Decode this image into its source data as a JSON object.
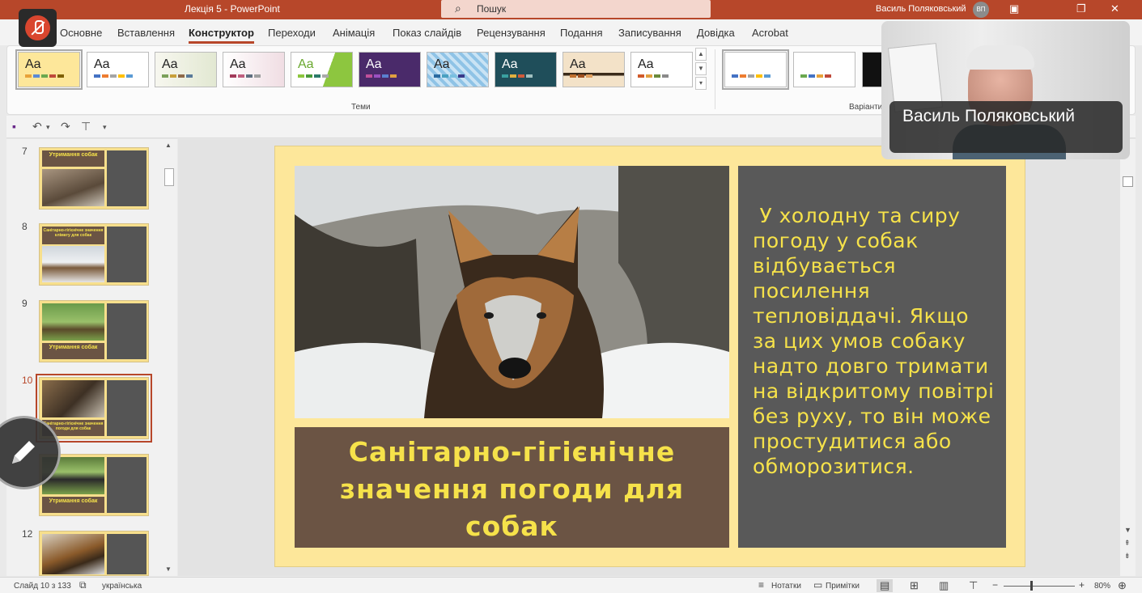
{
  "titlebar": {
    "title": "Лекція 5  -  PowerPoint",
    "search_placeholder": "Пошук",
    "user_name": "Василь Поляковський",
    "user_initials": "ВП"
  },
  "tabs": [
    "Основне",
    "Вставлення",
    "Конструктор",
    "Переходи",
    "Анімація",
    "Показ слайдів",
    "Рецензування",
    "Подання",
    "Записування",
    "Довідка",
    "Acrobat"
  ],
  "active_tab": "Конструктор",
  "ribbon": {
    "themes_label": "Теми",
    "variants_label": "Варіанти",
    "theme_sample": "Aa"
  },
  "slides_panel": {
    "thumbnails": [
      {
        "num": "7",
        "title": "Утримання собак"
      },
      {
        "num": "8",
        "title": "Санітарно-гігієнічне значення клімату для собак"
      },
      {
        "num": "9",
        "title": "Утримання собак"
      },
      {
        "num": "10",
        "title": "Санітарно-гігієнічне значення погоди для собак"
      },
      {
        "num": "",
        "title": "Утримання собак"
      },
      {
        "num": "12",
        "title": ""
      }
    ]
  },
  "slide": {
    "title": "Санітарно-гігієнічне значення погоди для собак",
    "body": " У холодну та сиру погоду у собак відбувається посилення тепловіддачі. Якщо за цих умов собаку надто довго тримати на відкритому повітрі без руху, то він може простудитися або обморозитися."
  },
  "video": {
    "participant_name": "Василь Поляковський"
  },
  "status": {
    "slide_counter": "Слайд 10 з 133",
    "language": "українська",
    "notes_label": "Нотатки",
    "comments_label": "Примітки",
    "zoom": "80%"
  },
  "colors": {
    "accent": "#b7472a",
    "slide_bg": "#fde79a",
    "title_box": "#6b5444",
    "body_box": "#595959",
    "slide_text": "#f6e24a"
  }
}
